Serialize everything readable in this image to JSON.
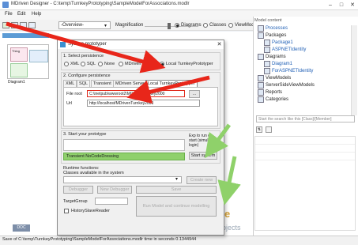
{
  "window": {
    "title": "MDriven Designer - C:\\temp\\TurnkeyPrototyping\\SampleModelForAssociations.modlr",
    "min": "–",
    "max": "□",
    "close": "✕"
  },
  "menu": [
    "File",
    "Edit",
    "Help"
  ],
  "toolbar": {
    "view_select": "-Overview-",
    "magnification_label": "Magnification",
    "radios": [
      "Diagrams",
      "Classes",
      "ViewMode"
    ]
  },
  "canvas": {
    "thumbnail_label": "Diagram1",
    "thumb_mini_title": "Thing",
    "doc_badge": "DOC"
  },
  "status": {
    "text": "Save of C:\\temp\\TurnkeyPrototyping\\SampleModelForAssociations.modlr time in seconds 0.1344944"
  },
  "model_panel": {
    "header": "Model content",
    "tree": [
      {
        "label": "Processes",
        "indent": 1,
        "link": true
      },
      {
        "label": "Packages",
        "indent": 1,
        "link": false
      },
      {
        "label": "Package1",
        "indent": 2,
        "link": true
      },
      {
        "label": "ASPNETIdentity",
        "indent": 2,
        "link": true
      },
      {
        "label": "Diagrams",
        "indent": 1,
        "link": false
      },
      {
        "label": "Diagram1",
        "indent": 2,
        "link": true
      },
      {
        "label": "ForASPNETIdentity",
        "indent": 2,
        "link": true
      },
      {
        "label": "ViewModels",
        "indent": 1,
        "link": false
      },
      {
        "label": "ServerSideViewModels",
        "indent": 1,
        "link": false
      },
      {
        "label": "Reports",
        "indent": 1,
        "link": false
      },
      {
        "label": "Categories",
        "indent": 1,
        "link": false
      }
    ],
    "search_placeholder": "Start the search like this [Class]/[Member]"
  },
  "dialog": {
    "title": "System prototyper",
    "close": "✕",
    "section1": "1. Select persistence",
    "persistence_options": [
      {
        "label": "XML",
        "checked": false
      },
      {
        "label": "SQL",
        "checked": false
      },
      {
        "label": "None",
        "checked": false
      },
      {
        "label": "MDriven Server",
        "checked": false
      },
      {
        "label": "Local TurnkeyPrototyper",
        "checked": true
      }
    ],
    "section2": "2. Configure persistence",
    "tabs": [
      "XML",
      "SQL",
      "Transient",
      "MDriven Server",
      "Local TurnkeyPrototyper"
    ],
    "file_root_label": "File root",
    "file_root_value": "C:\\inetpub\\wwwroot2\\MDrivenTurnkey2000",
    "browse_label": "...",
    "url_label": "Url",
    "url_value": "http://localhost/MDrivenTurnkey2000",
    "section3": "3. Start your prototype",
    "exp_note": "Exp to run on start (simulate login)",
    "start_button": "Start system",
    "status_bar": "Transient NoCodeDressing",
    "runtime_label": "Runtime functions:",
    "classes_label": "Classes available in the system",
    "debugger_button": "Debugger",
    "new_debugger_button": "New Debugger",
    "save_button": "Save",
    "create_button": "Create new",
    "target_group_label": "TargetGroup",
    "history_label": "HistorySlaveReader",
    "run_button": "Run Model and continue modelling"
  },
  "background": {
    "logo_line1": "e",
    "logo_line2": "Objects"
  },
  "colors": {
    "accent": "#5b9bd5",
    "highlight_red": "#e02a1c",
    "arrow_red": "#e8261a",
    "arrow_green": "#8fd16a",
    "status_green": "#8fd06c"
  }
}
